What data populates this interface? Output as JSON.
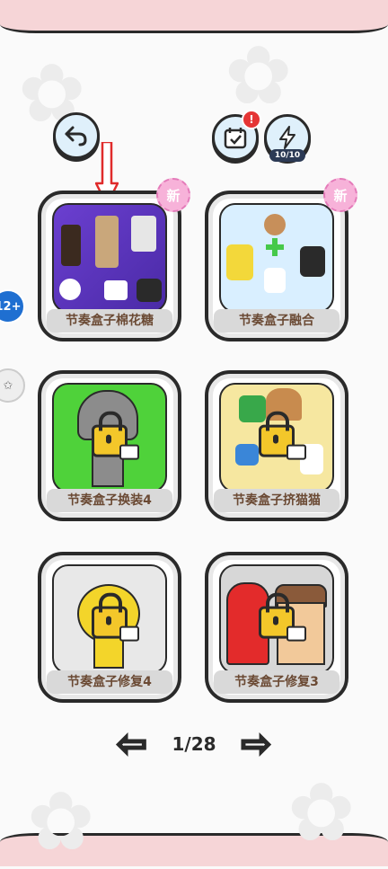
{
  "header": {
    "back_icon": "undo-arrow-icon",
    "calendar_icon": "calendar-icon",
    "calendar_alert": "!",
    "energy_icon": "lightning-icon",
    "energy_count": "10/10"
  },
  "side": {
    "age_badge": "12+",
    "star_icon": "star-badge-icon"
  },
  "cards": [
    {
      "label": "节奏盒子棉花糖",
      "badge": "新",
      "locked": false
    },
    {
      "label": "节奏盒子融合",
      "badge": "新",
      "locked": false
    },
    {
      "label": "节奏盒子换装4",
      "badge": "",
      "locked": true
    },
    {
      "label": "节奏盒子挤猫猫",
      "badge": "",
      "locked": true
    },
    {
      "label": "节奏盒子修复4",
      "badge": "",
      "locked": true
    },
    {
      "label": "节奏盒子修复3",
      "badge": "",
      "locked": true
    }
  ],
  "pager": {
    "text": "1/28"
  },
  "colors": {
    "accent_red_arrow": "#e02b2b",
    "label_text": "#6b4a34",
    "topbar_pink": "#f6d5d7"
  }
}
